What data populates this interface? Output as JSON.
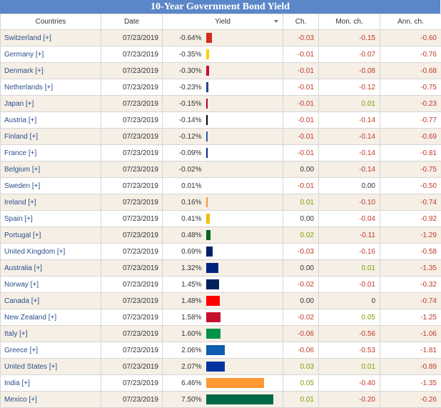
{
  "title": "10-Year Government Bond Yield",
  "headers": {
    "countries": "Countries",
    "date": "Date",
    "yield": "Yield",
    "ch": "Ch.",
    "mon_ch": "Mon. ch.",
    "ann_ch": "Ann. ch."
  },
  "icons": {
    "sort": "sort-arrow-icon"
  },
  "rows": [
    {
      "country": "Switzerland [+]",
      "date": "07/23/2019",
      "yield": "-0.64%",
      "yield_num": -0.64,
      "color": "#d52b1e",
      "ch": "-0.03",
      "mon": "-0.15",
      "ann": "-0.60"
    },
    {
      "country": "Germany [+]",
      "date": "07/23/2019",
      "yield": "-0.35%",
      "yield_num": -0.35,
      "color": "#ffce00",
      "ch": "-0.01",
      "mon": "-0.07",
      "ann": "-0.76"
    },
    {
      "country": "Denmark [+]",
      "date": "07/23/2019",
      "yield": "-0.30%",
      "yield_num": -0.3,
      "color": "#c8102e",
      "ch": "-0.01",
      "mon": "-0.08",
      "ann": "-0.68"
    },
    {
      "country": "Netherlands [+]",
      "date": "07/23/2019",
      "yield": "-0.23%",
      "yield_num": -0.23,
      "color": "#21468b",
      "ch": "-0.01",
      "mon": "-0.12",
      "ann": "-0.75"
    },
    {
      "country": "Japan [+]",
      "date": "07/23/2019",
      "yield": "-0.15%",
      "yield_num": -0.15,
      "color": "#bc002d",
      "ch": "-0.01",
      "mon": "0.01",
      "ann": "-0.23"
    },
    {
      "country": "Austria [+]",
      "date": "07/23/2019",
      "yield": "-0.14%",
      "yield_num": -0.14,
      "color": "#000000",
      "ch": "-0.01",
      "mon": "-0.14",
      "ann": "-0.77"
    },
    {
      "country": "Finland [+]",
      "date": "07/23/2019",
      "yield": "-0.12%",
      "yield_num": -0.12,
      "color": "#2c5ba8",
      "ch": "-0.01",
      "mon": "-0.14",
      "ann": "-0.69"
    },
    {
      "country": "France [+]",
      "date": "07/23/2019",
      "yield": "-0.09%",
      "yield_num": -0.09,
      "color": "#0a2a8c",
      "ch": "-0.01",
      "mon": "-0.14",
      "ann": "-0.81"
    },
    {
      "country": "Belgium [+]",
      "date": "07/23/2019",
      "yield": "-0.02%",
      "yield_num": -0.02,
      "color": "#000000",
      "ch": "0.00",
      "mon": "-0.14",
      "ann": "-0.75"
    },
    {
      "country": "Sweden [+]",
      "date": "07/23/2019",
      "yield": "0.01%",
      "yield_num": 0.01,
      "color": "#005293",
      "ch": "-0.01",
      "mon": "0.00",
      "ann": "-0.50"
    },
    {
      "country": "Ireland [+]",
      "date": "07/23/2019",
      "yield": "0.16%",
      "yield_num": 0.16,
      "color": "#f7943a",
      "ch": "0.01",
      "mon": "-0.10",
      "ann": "-0.74"
    },
    {
      "country": "Spain [+]",
      "date": "07/23/2019",
      "yield": "0.41%",
      "yield_num": 0.41,
      "color": "#f1bf00",
      "ch": "0.00",
      "mon": "-0.04",
      "ann": "-0.92"
    },
    {
      "country": "Portugal [+]",
      "date": "07/23/2019",
      "yield": "0.48%",
      "yield_num": 0.48,
      "color": "#00661c",
      "ch": "0.02",
      "mon": "-0.11",
      "ann": "-1.29"
    },
    {
      "country": "United Kingdom [+]",
      "date": "07/23/2019",
      "yield": "0.69%",
      "yield_num": 0.69,
      "color": "#012169",
      "ch": "-0.03",
      "mon": "-0.16",
      "ann": "-0.58"
    },
    {
      "country": "Australia [+]",
      "date": "07/23/2019",
      "yield": "1.32%",
      "yield_num": 1.32,
      "color": "#00247d",
      "ch": "0.00",
      "mon": "0.01",
      "ann": "-1.35"
    },
    {
      "country": "Norway [+]",
      "date": "07/23/2019",
      "yield": "1.45%",
      "yield_num": 1.45,
      "color": "#00205b",
      "ch": "-0.02",
      "mon": "-0.01",
      "ann": "-0.32"
    },
    {
      "country": "Canada [+]",
      "date": "07/23/2019",
      "yield": "1.48%",
      "yield_num": 1.48,
      "color": "#ff0000",
      "ch": "0.00",
      "mon": "0",
      "ann": "-0.74"
    },
    {
      "country": "New Zealand [+]",
      "date": "07/23/2019",
      "yield": "1.58%",
      "yield_num": 1.58,
      "color": "#c8102e",
      "ch": "-0.02",
      "mon": "0.05",
      "ann": "-1.25"
    },
    {
      "country": "Italy [+]",
      "date": "07/23/2019",
      "yield": "1.60%",
      "yield_num": 1.6,
      "color": "#009246",
      "ch": "-0.06",
      "mon": "-0.56",
      "ann": "-1.06"
    },
    {
      "country": "Greece [+]",
      "date": "07/23/2019",
      "yield": "2.06%",
      "yield_num": 2.06,
      "color": "#0d5eaf",
      "ch": "-0.06",
      "mon": "-0.53",
      "ann": "-1.81"
    },
    {
      "country": "United States [+]",
      "date": "07/23/2019",
      "yield": "2.07%",
      "yield_num": 2.07,
      "color": "#0033a0",
      "ch": "0.03",
      "mon": "0.01",
      "ann": "-0.89"
    },
    {
      "country": "India [+]",
      "date": "07/23/2019",
      "yield": "6.46%",
      "yield_num": 6.46,
      "color": "#ff9933",
      "ch": "0.05",
      "mon": "-0.40",
      "ann": "-1.35"
    },
    {
      "country": "Mexico [+]",
      "date": "07/23/2019",
      "yield": "7.50%",
      "yield_num": 7.5,
      "color": "#006847",
      "ch": "0.01",
      "mon": "-0.20",
      "ann": "-0.26"
    }
  ]
}
